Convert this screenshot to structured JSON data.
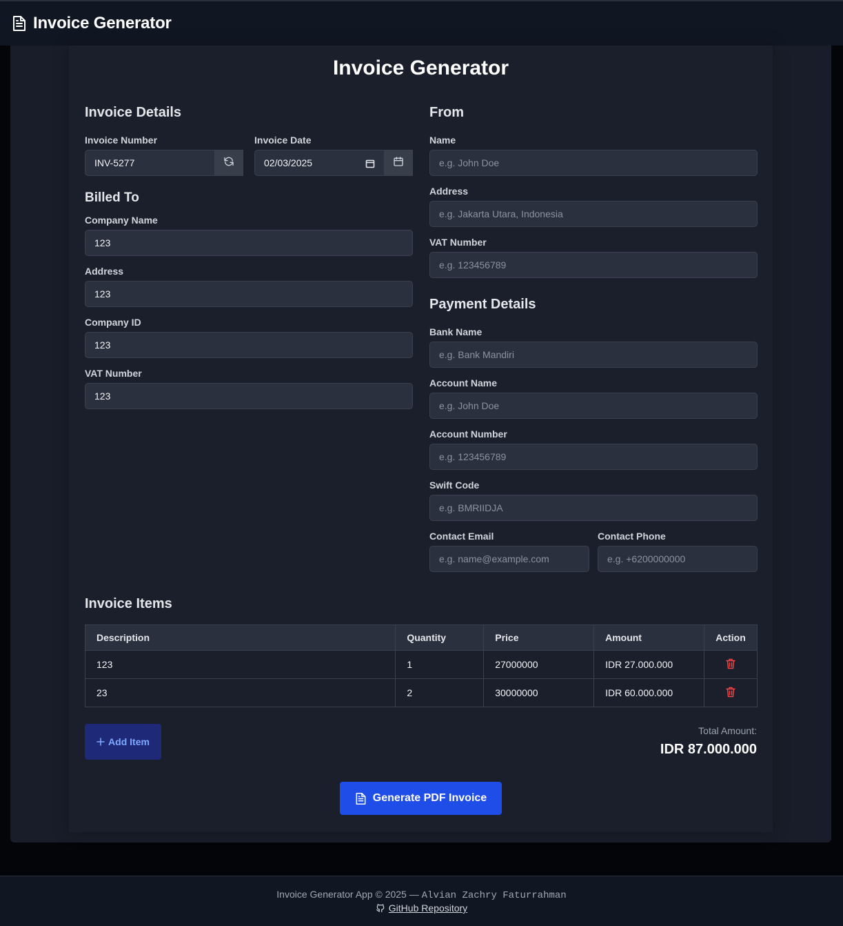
{
  "header": {
    "title": "Invoice Generator"
  },
  "page_title": "Invoice Generator",
  "invoice_details": {
    "heading": "Invoice Details",
    "number_label": "Invoice Number",
    "number_value": "INV-5277",
    "date_label": "Invoice Date",
    "date_value": "02/03/2025"
  },
  "billed_to": {
    "heading": "Billed To",
    "company_name_label": "Company Name",
    "company_name_value": "123",
    "address_label": "Address",
    "address_value": "123",
    "company_id_label": "Company ID",
    "company_id_value": "123",
    "vat_label": "VAT Number",
    "vat_value": "123"
  },
  "from": {
    "heading": "From",
    "name_label": "Name",
    "name_placeholder": "e.g. John Doe",
    "address_label": "Address",
    "address_placeholder": "e.g. Jakarta Utara, Indonesia",
    "vat_label": "VAT Number",
    "vat_placeholder": "e.g. 123456789"
  },
  "payment": {
    "heading": "Payment Details",
    "bank_label": "Bank Name",
    "bank_placeholder": "e.g. Bank Mandiri",
    "account_name_label": "Account Name",
    "account_name_placeholder": "e.g. John Doe",
    "account_number_label": "Account Number",
    "account_number_placeholder": "e.g. 123456789",
    "swift_label": "Swift Code",
    "swift_placeholder": "e.g. BMRIIDJA",
    "email_label": "Contact Email",
    "email_placeholder": "e.g. name@example.com",
    "phone_label": "Contact Phone",
    "phone_placeholder": "e.g. +6200000000"
  },
  "items": {
    "heading": "Invoice Items",
    "columns": [
      "Description",
      "Quantity",
      "Price",
      "Amount",
      "Action"
    ],
    "rows": [
      {
        "description": "123",
        "quantity": "1",
        "price": "27000000",
        "amount": "IDR 27.000.000"
      },
      {
        "description": "23",
        "quantity": "2",
        "price": "30000000",
        "amount": "IDR 60.000.000"
      }
    ],
    "add_label": "Add Item"
  },
  "total": {
    "label": "Total Amount:",
    "value": "IDR 87.000.000"
  },
  "generate_label": "Generate PDF Invoice",
  "footer": {
    "text": "Invoice Generator App © 2025 —",
    "author": "Alvian Zachry Faturrahman",
    "repo_label": "GitHub Repository"
  },
  "colors": {
    "accent": "#1f4de8",
    "add_button": "#1e2a78",
    "delete_icon": "#ef4444"
  }
}
